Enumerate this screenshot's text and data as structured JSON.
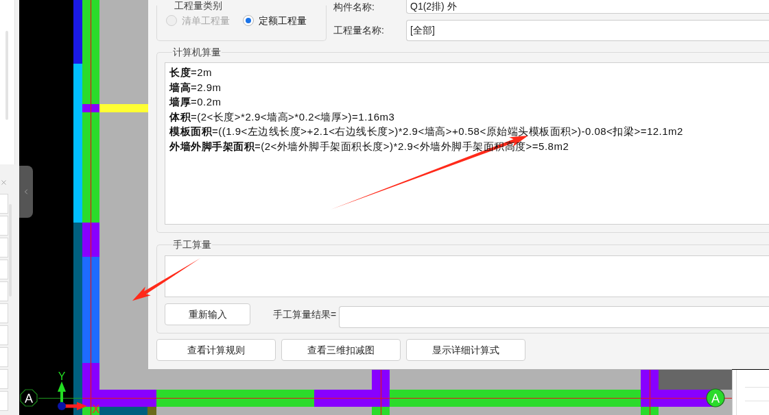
{
  "dialog": {
    "quantity_type": {
      "title": "工程量类别",
      "options": [
        {
          "label": "清单工程量",
          "selected": false,
          "disabled": true
        },
        {
          "label": "定额工程量",
          "selected": true,
          "disabled": false
        }
      ]
    },
    "fields": [
      {
        "label": "构件名称:",
        "value": "Q1(2排) 外"
      },
      {
        "label": "工程量名称:",
        "value": "[全部]"
      }
    ],
    "computed": {
      "title": "计算机算量",
      "lines": [
        "**长度**=2m",
        "**墙高**=2.9m",
        "**墙厚**=0.2m",
        "**体积**=(2<长度>*2.9<墙高>*0.2<墙厚>)=1.16m3",
        "**模板面积**=((1.9<左边线长度>+2.1<右边线长度>)*2.9<墙高>+0.58<原始端头模板面积>)-0.08<扣梁>=12.1m2",
        "**外墙外脚手架面积**=(2<外墙外脚手架面积长度>)*2.9<外墙外脚手架面积高度>=5.8m2"
      ]
    },
    "manual": {
      "title": "手工算量",
      "reenter_button": "重新输入",
      "result_label": "手工算量结果="
    },
    "buttons": [
      "查看计算规则",
      "查看三维扣减图",
      "显示详细计算式"
    ]
  },
  "canvas": {
    "axis_markers": [
      {
        "label": "A",
        "highlighted": false
      },
      {
        "label": "A",
        "highlighted": true
      }
    ],
    "x_axis_label": "X",
    "y_axis_label": "Y"
  }
}
